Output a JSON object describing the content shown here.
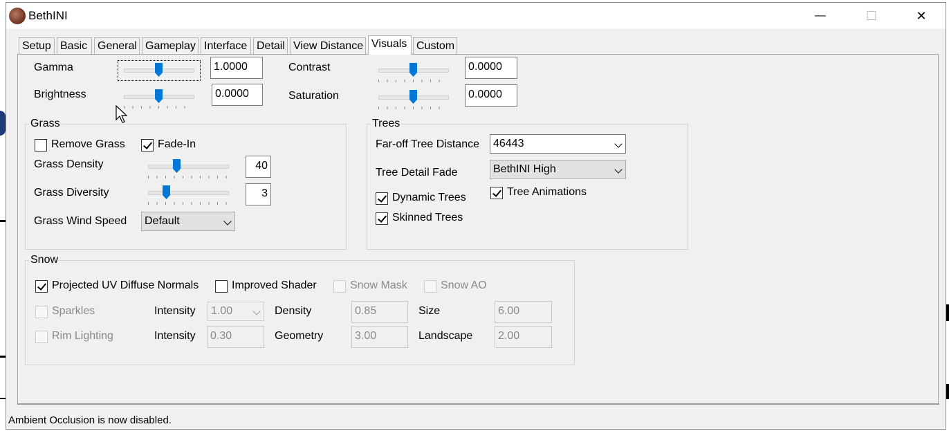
{
  "window": {
    "title": "BethINI",
    "controls": {
      "minimize": "—",
      "maximize": "☐",
      "close": "✕"
    }
  },
  "tabs": [
    {
      "label": "Setup",
      "active": false
    },
    {
      "label": "Basic",
      "active": false
    },
    {
      "label": "General",
      "active": false
    },
    {
      "label": "Gameplay",
      "active": false
    },
    {
      "label": "Interface",
      "active": false
    },
    {
      "label": "Detail",
      "active": false
    },
    {
      "label": "View Distance",
      "active": false
    },
    {
      "label": "Visuals",
      "active": true
    },
    {
      "label": "Custom",
      "active": false
    }
  ],
  "image_adjust": {
    "gamma": {
      "label": "Gamma",
      "value": "1.0000",
      "slider_fraction": 0.5
    },
    "brightness": {
      "label": "Brightness",
      "value": "0.0000",
      "slider_fraction": 0.5
    },
    "contrast": {
      "label": "Contrast",
      "value": "0.0000",
      "slider_fraction": 0.5
    },
    "saturation": {
      "label": "Saturation",
      "value": "0.0000",
      "slider_fraction": 0.5
    }
  },
  "grass": {
    "title": "Grass",
    "remove_grass": {
      "label": "Remove Grass",
      "checked": false
    },
    "fade_in": {
      "label": "Fade-In",
      "checked": true
    },
    "density": {
      "label": "Grass Density",
      "value": "40",
      "slider_fraction": 0.35
    },
    "diversity": {
      "label": "Grass Diversity",
      "value": "3",
      "slider_fraction": 0.2
    },
    "wind_speed": {
      "label": "Grass Wind Speed",
      "value": "Default"
    }
  },
  "trees": {
    "title": "Trees",
    "far_off_distance": {
      "label": "Far-off Tree Distance",
      "value": "46443"
    },
    "detail_fade": {
      "label": "Tree Detail Fade",
      "value": "BethINI High"
    },
    "dynamic_trees": {
      "label": "Dynamic Trees",
      "checked": true
    },
    "tree_animations": {
      "label": "Tree Animations",
      "checked": true
    },
    "skinned_trees": {
      "label": "Skinned Trees",
      "checked": true
    }
  },
  "snow": {
    "title": "Snow",
    "projected_uv": {
      "label": "Projected UV Diffuse Normals",
      "checked": true
    },
    "improved_shader": {
      "label": "Improved Shader",
      "checked": false
    },
    "snow_mask": {
      "label": "Snow Mask",
      "checked": false
    },
    "snow_ao": {
      "label": "Snow AO",
      "checked": false
    },
    "sparkles": {
      "label": "Sparkles",
      "checked": false
    },
    "sparkles_intensity": {
      "label": "Intensity",
      "value": "1.00"
    },
    "density": {
      "label": "Density",
      "value": "0.85"
    },
    "size": {
      "label": "Size",
      "value": "6.00"
    },
    "rim_lighting": {
      "label": "Rim Lighting",
      "checked": false
    },
    "rim_intensity": {
      "label": "Intensity",
      "value": "0.30"
    },
    "geometry": {
      "label": "Geometry",
      "value": "3.00"
    },
    "landscape": {
      "label": "Landscape",
      "value": "2.00"
    }
  },
  "status": "Ambient Occlusion is now disabled.",
  "colors": {
    "accent": "#0078d7",
    "window_bg": "#f0f0f0",
    "disabled_text": "#8a8a8a"
  }
}
